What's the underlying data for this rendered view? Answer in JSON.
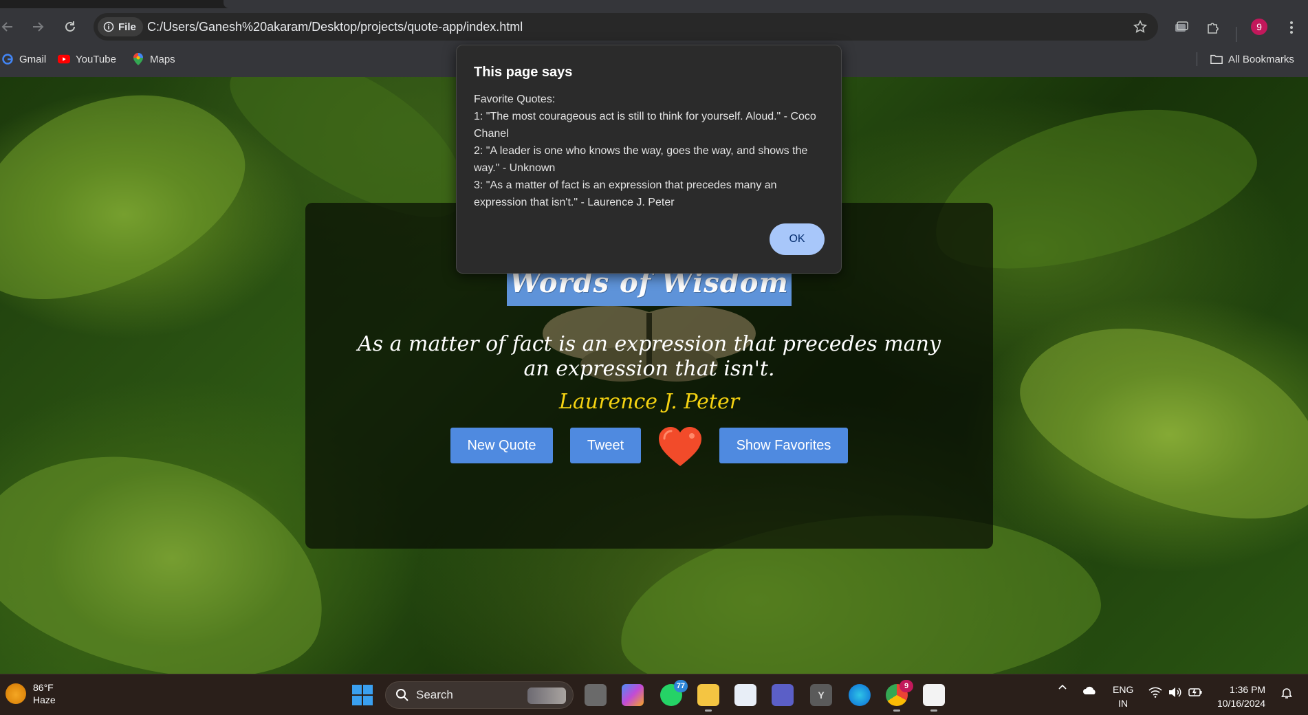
{
  "browser": {
    "url": "C:/Users/Ganesh%20akaram/Desktop/projects/quote-app/index.html",
    "chip_label": "File",
    "profile_letter": "9",
    "bookmarks": [
      "Gmail",
      "YouTube",
      "Maps"
    ],
    "all_bookmarks": "All Bookmarks"
  },
  "app": {
    "brand": "Words of Wisdom",
    "quote": "As a matter of fact is an expression that precedes many an expression that isn't.",
    "author": "Laurence J. Peter",
    "buttons": {
      "new_quote": "New Quote",
      "tweet": "Tweet",
      "show_favorites": "Show Favorites"
    },
    "colors": {
      "accent": "#4f8ae0",
      "author": "#f5d312"
    }
  },
  "dialog": {
    "title": "This page says",
    "body": "Favorite Quotes:\n1: \"The most courageous act is still to think for yourself. Aloud.\" - Coco Chanel\n2: \"A leader is one who knows the way, goes the way, and shows the way.\" - Unknown\n3: \"As a matter of fact is an expression that precedes many an expression that isn't.\" - Laurence J. Peter",
    "ok": "OK"
  },
  "taskbar": {
    "temperature": "86°F",
    "condition": "Haze",
    "search": "Search",
    "whatsapp_badge": "77",
    "chrome_badge": "9",
    "lang1": "ENG",
    "lang2": "IN",
    "time": "1:36 PM",
    "date": "10/16/2024"
  }
}
